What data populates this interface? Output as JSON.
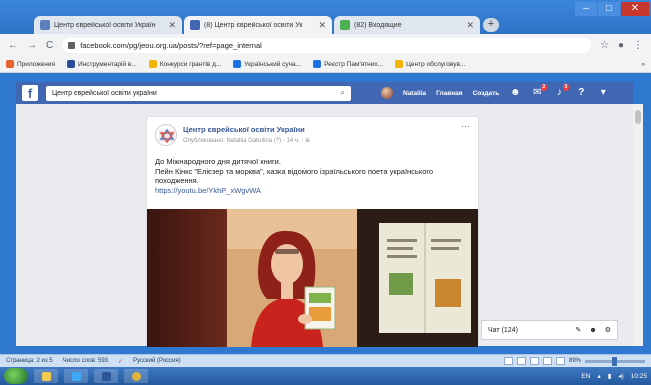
{
  "browser": {
    "tabs": [
      {
        "title": "Центр єврейської освіти Україн",
        "active": false,
        "favicon_color": "#5b7fb8",
        "left": 0
      },
      {
        "title": "(8) Центр єврейської освіти Ук",
        "active": true,
        "favicon_color": "#4267b2",
        "left": 0
      },
      {
        "title": "(82) Входящие",
        "active": false,
        "favicon_color": "#4caf50",
        "left": 0
      }
    ],
    "new_tab": "+",
    "window_controls": {
      "minimize": "–",
      "maximize": "□",
      "close": "✕"
    },
    "url": "facebook.com/pg/jeou.org.ua/posts/?ref=page_internal",
    "bookmarks": [
      {
        "label": "Приложения",
        "color": "#e8622c"
      },
      {
        "label": "Инструментарій в...",
        "color": "#2a4d9a"
      },
      {
        "label": "Конкурси грантів д...",
        "color": "#f4b400"
      },
      {
        "label": "Український суча...",
        "color": "#1a73e8"
      },
      {
        "label": "Реєстр Пам'ятних...",
        "color": "#1a73e8"
      },
      {
        "label": "Центр обслуговув...",
        "color": "#f4b400"
      }
    ],
    "bookmarks_more": "»"
  },
  "facebook": {
    "search_value": "Центр єврейської освіти україни",
    "user_name": "Nataliia",
    "nav_home": "Главная",
    "nav_create": "Создать",
    "badges": {
      "messages": "2",
      "notifications": "3"
    },
    "post": {
      "page_name": "Центр єврейської освіти України",
      "meta": "Опубликовано: Nataliia Gabulina (?) · 14 ч. · ⊕",
      "more": "···",
      "line1": "До Міжнародного дня дитячої книги.",
      "line2": "Пейн Кінкс \"Елієзер та морква\", казка відомого ізраїльського поета українського походження.",
      "link": "https://youtu.be/YkhP_xWgvWA"
    },
    "chat_label": "Чат (124)"
  },
  "word_status": {
    "page": "Страница: 2 из 5",
    "words": "Число слов: 593",
    "language": "Русский (Россия)",
    "zoom": "89%"
  },
  "taskbar": {
    "lang": "EN",
    "time": "10:25"
  }
}
